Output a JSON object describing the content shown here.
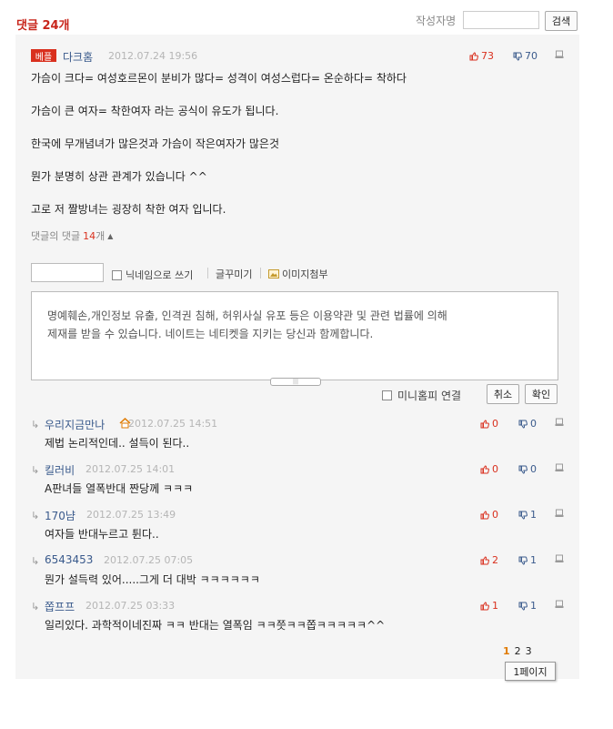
{
  "header": {
    "title": "댓글 24개",
    "search_label": "작성자명",
    "search_value": "",
    "search_button": "검색"
  },
  "main_comment": {
    "badge": "베플",
    "author": "다크홈",
    "date": "2012.07.24 19:56",
    "likes": "73",
    "dislikes": "70",
    "lines": [
      "가슴이 크다= 여성호르몬이 분비가 많다= 성격이 여성스럽다= 온순하다= 착하다",
      "가슴이 큰 여자= 착한여자 라는 공식이 유도가 됩니다.",
      "한국에 무개념녀가 많은것과 가슴이 작은여자가 많은것",
      "뭔가 분명히 상관 관계가 있습니다 ^^",
      "고로 저 짤방녀는 굉장히 착한 여자 입니다."
    ],
    "replies_label": "댓글의 댓글",
    "replies_count": "14",
    "replies_unit": "개"
  },
  "compose": {
    "nickname_value": "",
    "nickname_option": "닉네임으로 쓰기",
    "decorate_label": "글꾸미기",
    "image_label": "이미지첨부",
    "notice_line1": "명예훼손,개인정보 유출, 인격권 침해, 허위사실 유포 등은 이용약관 및 관련 법률에 의해",
    "notice_line2": "제재를 받을 수 있습니다. 네이트는 네티켓을 지키는 당신과 함께합니다.",
    "minihompy_label": "미니홈피 연결",
    "cancel_button": "취소",
    "confirm_button": "확인"
  },
  "replies": [
    {
      "author": "우리지금만나",
      "has_home_icon": true,
      "date": "2012.07.25 14:51",
      "text": "제법 논리적인데.. 설득이 된다..",
      "likes": "0",
      "dislikes": "0"
    },
    {
      "author": "킬러비",
      "has_home_icon": false,
      "date": "2012.07.25 14:01",
      "text": "A판녀들 열폭반대 짠당께 ㅋㅋㅋ",
      "likes": "0",
      "dislikes": "0"
    },
    {
      "author": "170냠",
      "has_home_icon": false,
      "date": "2012.07.25 13:49",
      "text": "여자들 반대누르고 튄다..",
      "likes": "0",
      "dislikes": "1"
    },
    {
      "author": "6543453",
      "has_home_icon": false,
      "date": "2012.07.25 07:05",
      "text": "뭔가 설득력 있어.....그게 더 대박 ㅋㅋㅋㅋㅋㅋ",
      "likes": "2",
      "dislikes": "1"
    },
    {
      "author": "쫍프프",
      "has_home_icon": false,
      "date": "2012.07.25 03:33",
      "text": "일리있다. 과학적이네진짜 ㅋㅋ 반대는 열폭임 ㅋㅋ쯧ㅋㅋ쫍ㅋㅋㅋㅋㅋ^^",
      "likes": "1",
      "dislikes": "1"
    }
  ],
  "pagination": {
    "pages": [
      "1",
      "2",
      "3"
    ],
    "current": "1",
    "tooltip": "1페이지"
  },
  "colors": {
    "accent": "#d9301e",
    "link": "#3a5a8c",
    "panel": "#f5f5f5"
  }
}
